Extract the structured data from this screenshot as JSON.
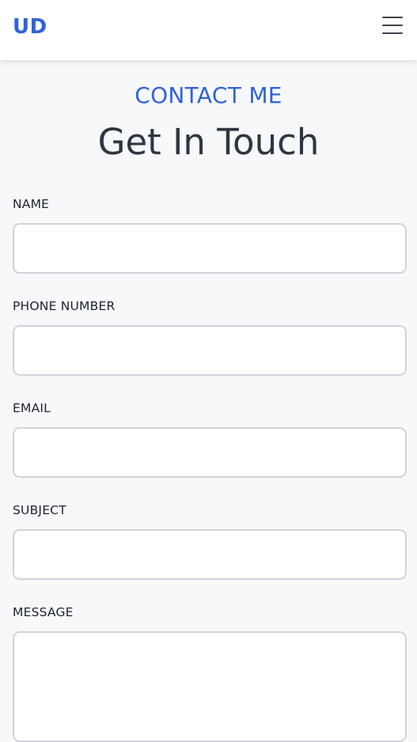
{
  "nav": {
    "logo": "UD",
    "menu_icon": "hamburger-menu-icon"
  },
  "section": {
    "label": "CONTACT ME",
    "title": "Get In Touch"
  },
  "form": {
    "name_label": "NAME",
    "name_value": "",
    "phone_label": "PHONE NUMBER",
    "phone_value": "",
    "email_label": "EMAIL",
    "email_value": "",
    "subject_label": "SUBJECT",
    "subject_value": "",
    "message_label": "MESSAGE",
    "message_value": ""
  },
  "colors": {
    "accent": "#2f62d8",
    "text": "#2f3542",
    "background": "#f7f8fa",
    "input_border": "#cfd3da"
  }
}
